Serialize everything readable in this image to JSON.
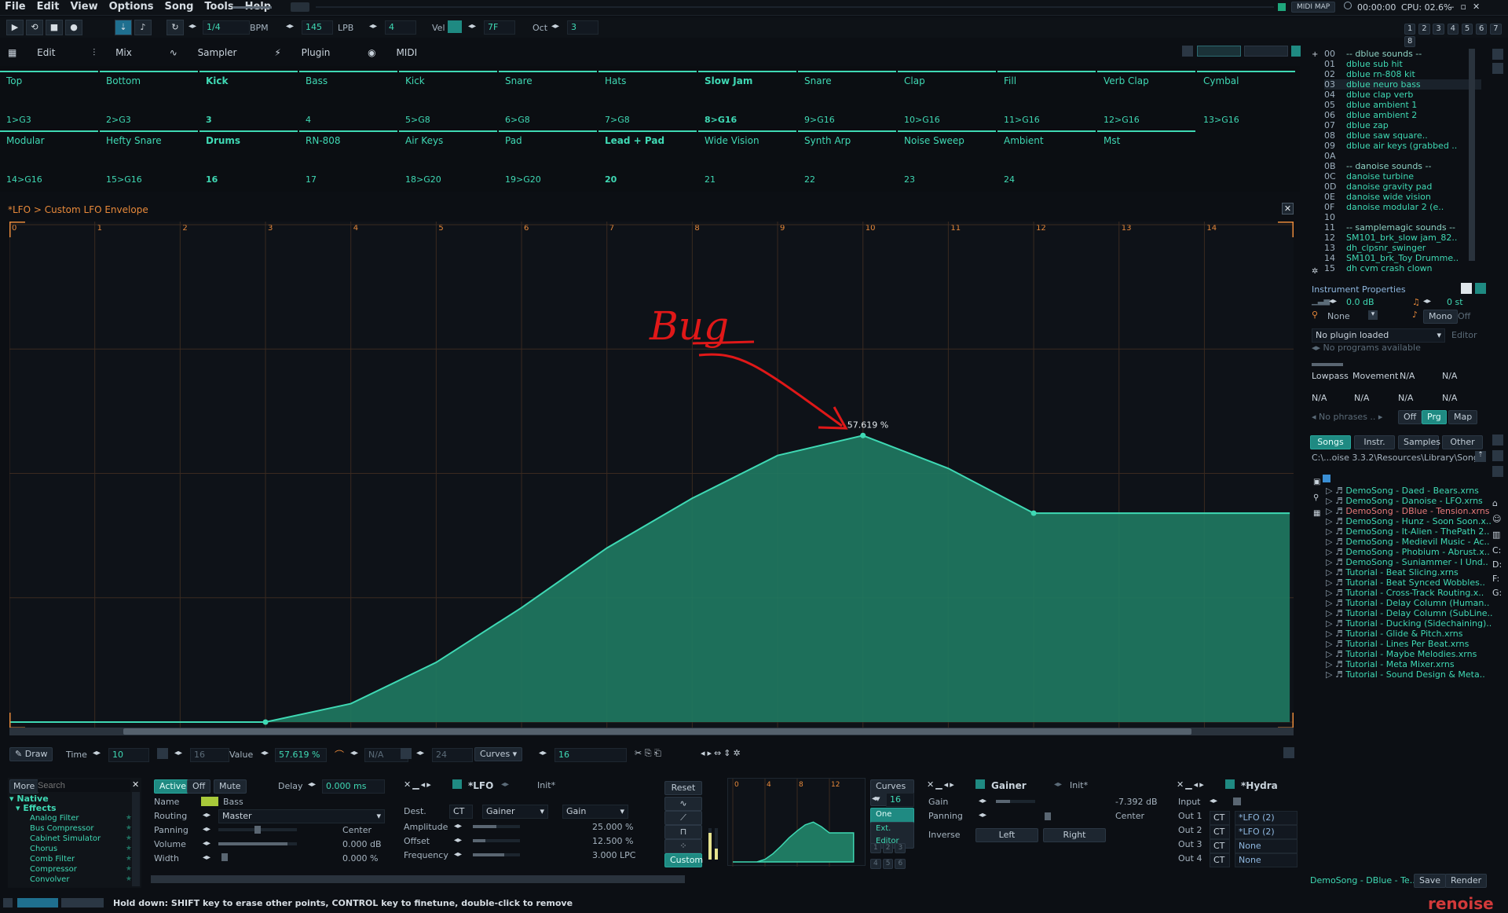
{
  "menu": [
    "File",
    "Edit",
    "View",
    "Options",
    "Song",
    "Tools",
    "Help"
  ],
  "topbar": {
    "midi_map": "MIDI MAP",
    "time": "00:00:00",
    "cpu": "CPU: 02.6%"
  },
  "transport": {
    "pattern_step": "1/4",
    "bpm_label": "BPM",
    "bpm": "145",
    "lpb_label": "LPB",
    "lpb": "4",
    "vel_label": "Vel",
    "vel": "7F",
    "oct_label": "Oct",
    "oct": "3",
    "tracks_nums": [
      "1",
      "2",
      "3",
      "4",
      "5",
      "6",
      "7",
      "8"
    ]
  },
  "viewtabs": [
    "Edit",
    "Mix",
    "Sampler",
    "Plugin",
    "MIDI"
  ],
  "tracks_row1": [
    {
      "name": "Top",
      "num": "1>G3"
    },
    {
      "name": "Bottom",
      "num": "2>G3"
    },
    {
      "name": "Kick",
      "num": "3",
      "bold": true
    },
    {
      "name": "Bass",
      "num": "4"
    },
    {
      "name": "Kick",
      "num": "5>G8"
    },
    {
      "name": "Snare",
      "num": "6>G8"
    },
    {
      "name": "Hats",
      "num": "7>G8"
    },
    {
      "name": "Slow Jam",
      "num": "8>G16",
      "bold": true
    },
    {
      "name": "Snare",
      "num": "9>G16"
    },
    {
      "name": "Clap",
      "num": "10>G16"
    },
    {
      "name": "Fill",
      "num": "11>G16"
    },
    {
      "name": "Verb Clap",
      "num": "12>G16"
    },
    {
      "name": "Cymbal",
      "num": "13>G16"
    }
  ],
  "tracks_row2": [
    {
      "name": "Modular",
      "num": "14>G16"
    },
    {
      "name": "Hefty Snare",
      "num": "15>G16"
    },
    {
      "name": "Drums",
      "num": "16",
      "bold": true
    },
    {
      "name": "RN-808",
      "num": "17"
    },
    {
      "name": "Air Keys",
      "num": "18>G20"
    },
    {
      "name": "Pad",
      "num": "19>G20"
    },
    {
      "name": "Lead + Pad",
      "num": "20",
      "bold": true
    },
    {
      "name": "Wide Vision",
      "num": "21"
    },
    {
      "name": "Synth Arp",
      "num": "22"
    },
    {
      "name": "Noise Sweep",
      "num": "23"
    },
    {
      "name": "Ambient",
      "num": "24"
    },
    {
      "name": "Mst",
      "num": ""
    }
  ],
  "lfo_title": "*LFO > Custom LFO Envelope",
  "graph": {
    "ticks": [
      "0",
      "1",
      "2",
      "3",
      "4",
      "5",
      "6",
      "7",
      "8",
      "9",
      "10",
      "11",
      "12",
      "13",
      "14"
    ],
    "tooltip": "57.619 %",
    "annotation": "Bug"
  },
  "chart_data": {
    "type": "line",
    "x": [
      0,
      1,
      2,
      3,
      4,
      5,
      6,
      7,
      8,
      9,
      10,
      11,
      12,
      13,
      14,
      15
    ],
    "values": [
      0,
      0,
      0,
      0,
      3.7,
      12,
      23,
      35,
      45,
      53.6,
      57.619,
      51,
      42,
      42,
      42,
      42
    ],
    "ylim": [
      0,
      100
    ],
    "xlim": [
      0,
      15
    ]
  },
  "graph_toolbar": {
    "draw": "Draw",
    "time_label": "Time",
    "time": "10",
    "len": "16",
    "value_label": "Value",
    "value": "57.619 %",
    "na": "N/A",
    "steps": "24",
    "curves": "Curves",
    "count": "16"
  },
  "effects": {
    "more": "More",
    "search_placeholder": "Search",
    "native": "Native",
    "effects": "Effects",
    "items": [
      "Analog Filter",
      "Bus Compressor",
      "Cabinet Simulator",
      "Chorus",
      "Comb Filter",
      "Compressor",
      "Convolver"
    ]
  },
  "track_dsp": {
    "active": "Active",
    "off": "Off",
    "mute": "Mute",
    "delay_label": "Delay",
    "delay": "0.000 ms",
    "name_label": "Name",
    "name": "Bass",
    "routing_label": "Routing",
    "routing": "Master",
    "panning_label": "Panning",
    "panning": "Center",
    "volume_label": "Volume",
    "volume": "0.000 dB",
    "width_label": "Width",
    "width": "0.000 %"
  },
  "lfo_device": {
    "title": "*LFO",
    "preset": "Init*",
    "dest_label": "Dest.",
    "dest_ct": "CT",
    "dest_device": "Gainer",
    "dest_param": "Gain",
    "amp_label": "Amplitude",
    "amp": "25.000 %",
    "off_label": "Offset",
    "off": "12.500 %",
    "freq_label": "Frequency",
    "freq": "3.000 LPC",
    "reset": "Reset",
    "custom": "Custom",
    "curves": "Curves",
    "curves_count": "16",
    "oneshot": "One Shot",
    "ext_editor": "Ext. Editor",
    "mini_ticks": [
      "0",
      "4",
      "8",
      "12"
    ],
    "grid_nums": [
      "1",
      "2",
      "3",
      "4",
      "5",
      "6"
    ]
  },
  "gainer": {
    "title": "Gainer",
    "preset": "Init*",
    "gain_label": "Gain",
    "gain": "-7.392 dB",
    "panning_label": "Panning",
    "panning": "Center",
    "inverse_label": "Inverse",
    "left": "Left",
    "right": "Right"
  },
  "hydra": {
    "title": "*Hydra",
    "input_label": "Input",
    "outs": [
      {
        "label": "Out 1",
        "ct": "CT",
        "val": "*LFO (2)"
      },
      {
        "label": "Out 2",
        "ct": "CT",
        "val": "*LFO (2)"
      },
      {
        "label": "Out 3",
        "ct": "CT",
        "val": "None"
      },
      {
        "label": "Out 4",
        "ct": "CT",
        "val": "None"
      }
    ]
  },
  "instruments": {
    "rows": [
      {
        "i": "00",
        "n": "-- dblue sounds --"
      },
      {
        "i": "01",
        "n": "dblue sub hit"
      },
      {
        "i": "02",
        "n": "dblue rn-808 kit"
      },
      {
        "i": "03",
        "n": "dblue neuro bass"
      },
      {
        "i": "04",
        "n": "dblue clap verb"
      },
      {
        "i": "05",
        "n": "dblue ambient 1"
      },
      {
        "i": "06",
        "n": "dblue ambient 2"
      },
      {
        "i": "07",
        "n": "dblue zap"
      },
      {
        "i": "08",
        "n": "dblue saw square.."
      },
      {
        "i": "09",
        "n": "dblue air keys (grabbed .."
      },
      {
        "i": "0A",
        "n": ""
      },
      {
        "i": "0B",
        "n": "-- danoise sounds --"
      },
      {
        "i": "0C",
        "n": "danoise turbine"
      },
      {
        "i": "0D",
        "n": "danoise gravity pad"
      },
      {
        "i": "0E",
        "n": "danoise wide vision"
      },
      {
        "i": "0F",
        "n": "danoise modular 2 (e.."
      },
      {
        "i": "10",
        "n": ""
      },
      {
        "i": "11",
        "n": "-- samplemagic sounds --"
      },
      {
        "i": "12",
        "n": "SM101_brk_slow jam_82.."
      },
      {
        "i": "13",
        "n": "dh_clpsnr_swinger"
      },
      {
        "i": "14",
        "n": "SM101_brk_Toy Drumme.."
      },
      {
        "i": "15",
        "n": "dh cvm crash clown"
      }
    ]
  },
  "inst_props": {
    "title": "Instrument Properties",
    "vol": "0.0 dB",
    "transpose": "0 st",
    "none": "None",
    "mono": "Mono",
    "off": "Off",
    "no_plugin": "No plugin loaded",
    "editor": "Editor",
    "no_programs": "No programs available",
    "lowpass": "Lowpass",
    "movement": "Movement",
    "na": "N/A",
    "no_phrases": "No phrases ..",
    "off_btn": "Off",
    "prg": "Prg",
    "map": "Map"
  },
  "browser": {
    "tabs": [
      "Songs",
      "Instr.",
      "Samples",
      "Other"
    ],
    "path": "C:\\...oise 3.3.2\\Resources\\Library\\Songs\\",
    "files": [
      "DemoSong - Daed - Bears.xrns",
      "DemoSong - Danoise - LFO.xrns",
      "DemoSong - DBlue - Tension.xrns",
      "DemoSong - Hunz - Soon Soon.x..",
      "DemoSong - It-Alien - ThePath 2..",
      "DemoSong - Medievil Music - Ac..",
      "DemoSong - Phobium - Abrust.x..",
      "DemoSong - Suniammer - I Und..",
      "Tutorial - Beat Slicing.xrns",
      "Tutorial - Beat Synced Wobbles..",
      "Tutorial - Cross-Track Routing.x..",
      "Tutorial - Delay Column (Human..",
      "Tutorial - Delay Column (SubLine..",
      "Tutorial - Ducking (Sidechaining)..",
      "Tutorial - Glide & Pitch.xrns",
      "Tutorial - Lines Per Beat.xrns",
      "Tutorial - Maybe Melodies.xrns",
      "Tutorial - Meta Mixer.xrns",
      "Tutorial - Sound Design & Meta.."
    ],
    "drives": [
      "C:",
      "D:",
      "F:",
      "G:"
    ],
    "current": "DemoSong - DBlue - Te..",
    "save": "Save",
    "render": "Render"
  },
  "status": {
    "text": "Hold down: SHIFT key to erase other points, CONTROL key to finetune, double-click to remove",
    "logo": "renoise"
  },
  "colors": {
    "accent": "#3fd9b4",
    "orange": "#e8893a",
    "annotation": "#e01818"
  }
}
